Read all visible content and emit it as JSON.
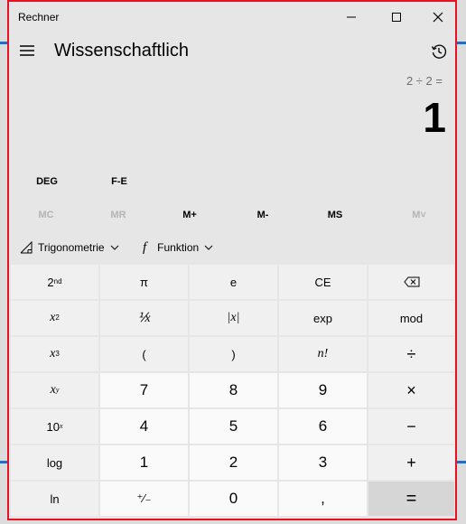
{
  "window": {
    "title": "Rechner"
  },
  "header": {
    "mode_title": "Wissenschaftlich"
  },
  "display": {
    "expression": "2 ÷ 2 =",
    "result": "1"
  },
  "angle_row": {
    "angle_unit": "DEG",
    "fe_label": "F-E"
  },
  "memory": {
    "mc": "MC",
    "mr": "MR",
    "mplus": "M+",
    "mminus": "M-",
    "ms": "MS",
    "mlist": "M˅"
  },
  "functions": {
    "trig_label": "Trigonometrie",
    "func_label": "Funktion"
  },
  "keys": {
    "second_base": "2",
    "second_sup": "nd",
    "pi": "π",
    "e": "e",
    "ce": "CE",
    "sq_base": "x",
    "sq_sup": "2",
    "recip": "⅟x",
    "abs": "|x|",
    "exp": "exp",
    "mod": "mod",
    "cube_base": "x",
    "cube_sup": "3",
    "lparen": "(",
    "rparen": ")",
    "fact": "n!",
    "div": "÷",
    "pow_base": "x",
    "pow_sup": "y",
    "n7": "7",
    "n8": "8",
    "n9": "9",
    "mul": "×",
    "ten_base": "10",
    "ten_sup": "x",
    "n4": "4",
    "n5": "5",
    "n6": "6",
    "minus": "−",
    "log": "log",
    "n1": "1",
    "n2": "2",
    "n3": "3",
    "plus": "+",
    "ln": "ln",
    "negate": "⁺∕₋",
    "n0": "0",
    "decimal": ",",
    "equals": "="
  }
}
